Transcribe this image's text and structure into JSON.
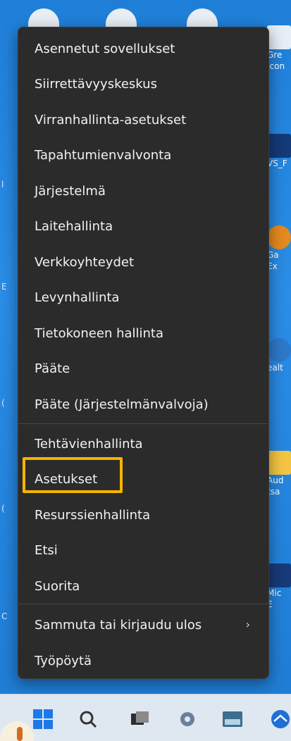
{
  "menu": {
    "items": [
      {
        "label": "Asennetut sovellukset"
      },
      {
        "label": "Siirrettävyyskeskus"
      },
      {
        "label": "Virranhallinta-asetukset"
      },
      {
        "label": "Tapahtumienvalvonta"
      },
      {
        "label": "Järjestelmä"
      },
      {
        "label": "Laitehallinta"
      },
      {
        "label": "Verkkoyhteydet"
      },
      {
        "label": "Levynhallinta"
      },
      {
        "label": "Tietokoneen hallinta"
      },
      {
        "label": "Pääte"
      },
      {
        "label": "Pääte (Järjestelmänvalvoja)"
      },
      {
        "label": "Tehtävienhallinta"
      },
      {
        "label": "Asetukset"
      },
      {
        "label": "Resurssienhallinta"
      },
      {
        "label": "Etsi"
      },
      {
        "label": "Suorita"
      },
      {
        "label": "Sammuta tai kirjaudu ulos",
        "submenu_indicator": "›"
      },
      {
        "label": "Työpöytä"
      }
    ],
    "highlighted_item": "Asetukset",
    "highlight_color": "#f4b400"
  },
  "desktop_right_labels": [
    "Gre",
    "Icon",
    "VS_F",
    "Ga",
    "Ex",
    "ealt",
    "Aud",
    "tsa",
    "Mic",
    "E"
  ],
  "taskbar": {
    "icons": [
      "windows-start-icon",
      "search-icon",
      "task-view-icon",
      "settings-icon",
      "keyboard-app-icon",
      "network-app-icon"
    ]
  }
}
